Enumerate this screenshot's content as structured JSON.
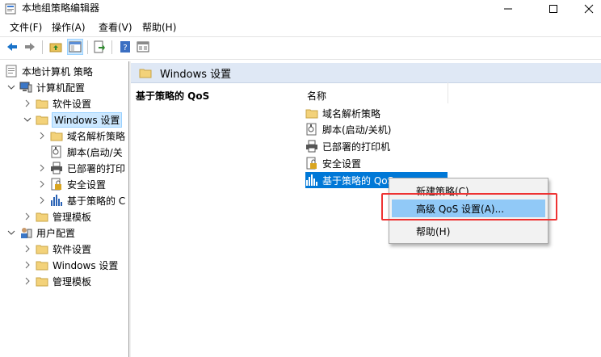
{
  "window": {
    "title": "本地组策略编辑器"
  },
  "menu": [
    "文件(F)",
    "操作(A)",
    "查看(V)",
    "帮助(H)"
  ],
  "tree": {
    "root": "本地计算机 策略",
    "computer_config": "计算机配置",
    "software_settings": "软件设置",
    "windows_settings": "Windows 设置",
    "dns_policy": "域名解析策略",
    "scripts": "脚本(启动/关",
    "printers": "已部署的打印",
    "security": "安全设置",
    "qos": "基于策略的 C",
    "admin_templates": "管理模板",
    "user_config": "用户配置",
    "user_software": "软件设置",
    "user_windows": "Windows 设置",
    "user_admin": "管理模板"
  },
  "content": {
    "header": "Windows 设置",
    "section_title": "基于策略的 QoS",
    "column": "名称",
    "items": [
      "域名解析策略",
      "脚本(启动/关机)",
      "已部署的打印机",
      "安全设置",
      "基于策略的 QoS"
    ]
  },
  "context_menu": {
    "new_policy": "新建策略(C)...",
    "advanced_qos": "高级 QoS 设置(A)...",
    "help": "帮助(H)"
  },
  "colors": {
    "selection": "#0078d7",
    "menu_hover": "#91c9f7",
    "highlight_box": "#e33333",
    "header_band": "#dfe8f5"
  }
}
